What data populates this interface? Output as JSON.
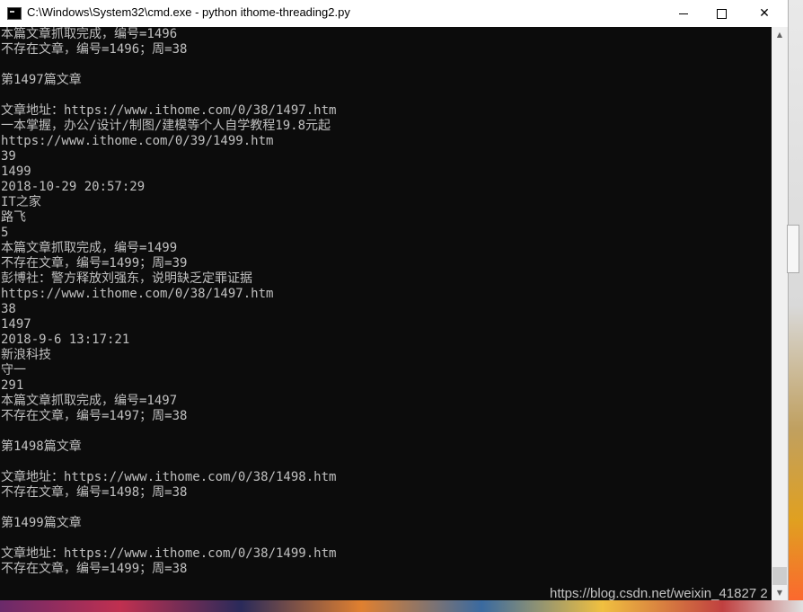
{
  "window": {
    "title": "C:\\Windows\\System32\\cmd.exe - python  ithome-threading2.py",
    "controls": {
      "minimize": "",
      "maximize": "",
      "close": "✕"
    }
  },
  "console": {
    "lines": [
      "本篇文章抓取完成，编号=1496",
      "不存在文章，编号=1496；周=38",
      "",
      "第1497篇文章",
      "",
      "文章地址：https://www.ithome.com/0/38/1497.htm",
      "一本掌握，办公/设计/制图/建模等个人自学教程19.8元起",
      "https://www.ithome.com/0/39/1499.htm",
      "39",
      "1499",
      "2018-10-29 20:57:29",
      "IT之家",
      "路飞",
      "5",
      "本篇文章抓取完成，编号=1499",
      "不存在文章，编号=1499；周=39",
      "彭博社：警方释放刘强东，说明缺乏定罪证据",
      "https://www.ithome.com/0/38/1497.htm",
      "38",
      "1497",
      "2018-9-6 13:17:21",
      "新浪科技",
      "守一",
      "291",
      "本篇文章抓取完成，编号=1497",
      "不存在文章，编号=1497；周=38",
      "",
      "第1498篇文章",
      "",
      "文章地址：https://www.ithome.com/0/38/1498.htm",
      "不存在文章，编号=1498；周=38",
      "",
      "第1499篇文章",
      "",
      "文章地址：https://www.ithome.com/0/38/1499.htm",
      "不存在文章，编号=1499；周=38"
    ]
  },
  "scrollbar": {
    "up_arrow": "▲",
    "down_arrow": "▼"
  },
  "watermark": "https://blog.csdn.net/weixin_41827 2",
  "colors": {
    "console_bg": "#0c0c0c",
    "console_fg": "#c0c0c0"
  }
}
